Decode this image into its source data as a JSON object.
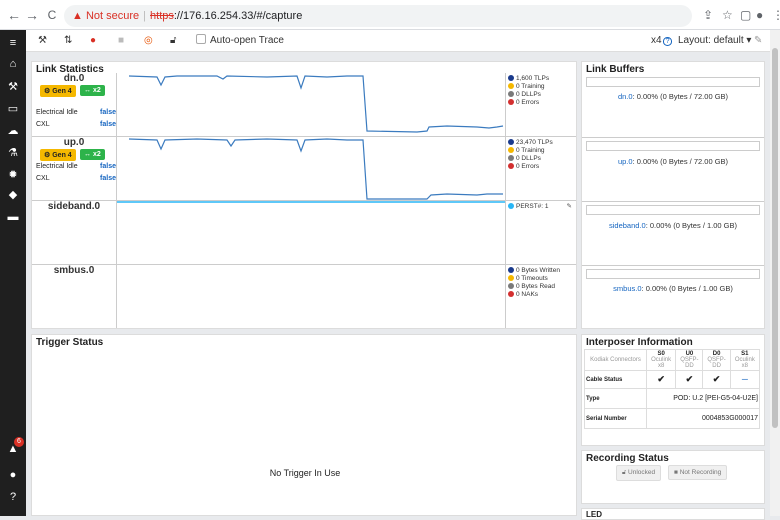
{
  "browser": {
    "back": "←",
    "forward": "→",
    "reload": "C",
    "warn_icon": "▲",
    "not_secure": "Not secure",
    "url_scheme": "https",
    "url_rest": "://176.16.254.33/#/capture"
  },
  "toolbar": {
    "auto_open_trace": "Auto-open Trace",
    "x4": "x4",
    "help": "?",
    "layout": "Layout: default"
  },
  "sidebar": {
    "notifications_count": "6"
  },
  "link_stats": {
    "title": "Link Statistics",
    "links": [
      {
        "name": "dn.0",
        "gen": "Gen 4",
        "width": "x2",
        "electrical_idle_label": "Electrical Idle",
        "electrical_idle": "false",
        "cxl_label": "CXL",
        "cxl": "false",
        "legend": [
          "1,600 TLPs",
          "0 Training",
          "0 DLLPs",
          "0 Errors"
        ]
      },
      {
        "name": "up.0",
        "gen": "Gen 4",
        "width": "x2",
        "electrical_idle_label": "Electrical Idle",
        "electrical_idle": "false",
        "cxl_label": "CXL",
        "cxl": "false",
        "legend": [
          "23,470 TLPs",
          "0 Training",
          "0 DLLPs",
          "0 Errors"
        ]
      },
      {
        "name": "sideband.0",
        "legend": [
          "PERST#: 1"
        ]
      },
      {
        "name": "smbus.0",
        "legend": [
          "0 Bytes Written",
          "0 Timeouts",
          "0 Bytes Read",
          "0 NAKs"
        ]
      }
    ],
    "legend_colors": [
      "#1a3a8c",
      "#f5b800",
      "#7a7a7a",
      "#d32f2f"
    ],
    "sideband_color": "#29b6f6"
  },
  "link_buffers": {
    "title": "Link Buffers",
    "items": [
      {
        "name": "dn.0",
        "text": ": 0.00% (0 Bytes / 72.00 GB)"
      },
      {
        "name": "up.0",
        "text": ": 0.00% (0 Bytes / 72.00 GB)"
      },
      {
        "name": "sideband.0",
        "text": ": 0.00% (0 Bytes / 1.00 GB)"
      },
      {
        "name": "smbus.0",
        "text": ": 0.00% (0 Bytes / 1.00 GB)"
      }
    ]
  },
  "trigger": {
    "title": "Trigger Status",
    "message": "No Trigger In Use"
  },
  "interposer": {
    "title": "Interposer Information",
    "connectors_label": "Kodiak Connectors",
    "columns": [
      {
        "head": "S0",
        "sub1": "Oculink",
        "sub2": "x8"
      },
      {
        "head": "U0",
        "sub1": "QSFP-",
        "sub2": "DD"
      },
      {
        "head": "D0",
        "sub1": "QSFP-",
        "sub2": "DD"
      },
      {
        "head": "S1",
        "sub1": "Oculink",
        "sub2": "x8"
      }
    ],
    "cable_status_label": "Cable Status",
    "cable_status": [
      "✔",
      "✔",
      "✔",
      "—"
    ],
    "type_label": "Type",
    "type_value": "POD: U.2 [PEI-G5-04-U2E]",
    "serial_label": "Serial Number",
    "serial_value": "0004853G000017"
  },
  "recording": {
    "title": "Recording Status",
    "unlocked": "Unlocked",
    "not_recording": "Not Recording"
  },
  "led_title": "LED"
}
